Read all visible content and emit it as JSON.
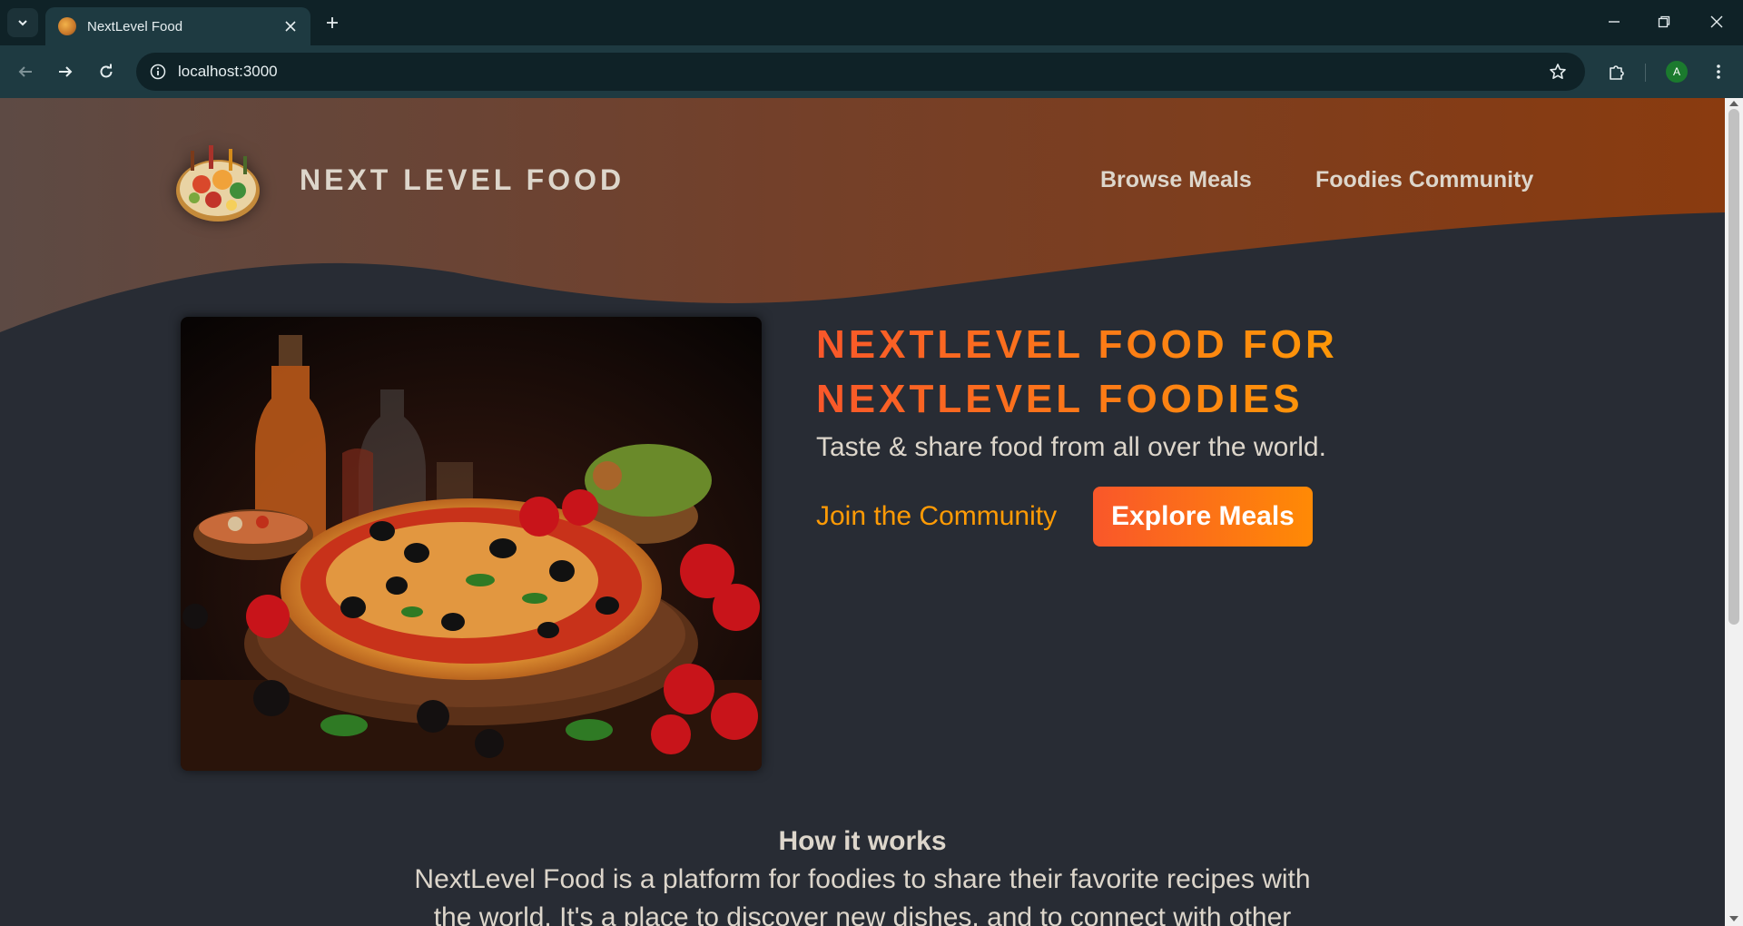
{
  "browser": {
    "tab_title": "NextLevel Food",
    "url": "localhost:3000",
    "profile_initial": "A"
  },
  "header": {
    "logo_text": "NEXT LEVEL FOOD",
    "nav": [
      {
        "label": "Browse Meals"
      },
      {
        "label": "Foodies Community"
      }
    ]
  },
  "hero": {
    "title": "NEXTLEVEL FOOD FOR NEXTLEVEL FOODIES",
    "subtitle": "Taste & share food from all over the world.",
    "join_link": "Join the Community",
    "explore_button": "Explore Meals"
  },
  "how_it_works": {
    "title": "How it works",
    "text": "NextLevel Food is a platform for foodies to share their favorite recipes with the world. It's a place to discover new dishes, and to connect with other"
  },
  "colors": {
    "page_bg": "#282c34",
    "header_gradient_start": "#5e4a40",
    "header_gradient_end": "#8a3d10",
    "accent_orange": "#ff9b05",
    "accent_red": "#f9572a",
    "text_light": "#ddd6cb"
  }
}
